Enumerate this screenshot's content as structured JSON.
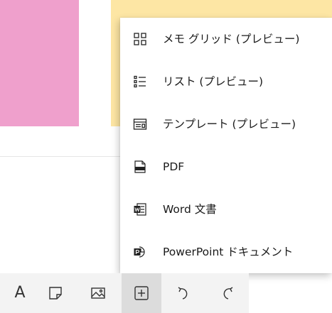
{
  "menu": {
    "items": [
      {
        "label": "メモ グリッド (プレビュー)",
        "icon": "grid-icon"
      },
      {
        "label": "リスト (プレビュー)",
        "icon": "list-icon"
      },
      {
        "label": "テンプレート (プレビュー)",
        "icon": "template-icon"
      },
      {
        "label": "PDF",
        "icon": "pdf-icon"
      },
      {
        "label": "Word 文書",
        "icon": "word-icon"
      },
      {
        "label": "PowerPoint ドキュメント",
        "icon": "powerpoint-icon"
      }
    ]
  },
  "toolbar": {
    "text_glyph": "A",
    "buttons": [
      "text-icon",
      "sticky-note-icon",
      "image-icon",
      "insert-icon",
      "undo-icon",
      "redo-icon"
    ],
    "active": "insert-icon"
  },
  "colors": {
    "pink_note": "#efa0cc",
    "yellow_note": "#fde6a4",
    "toolbar_bg": "#f3f3f3",
    "active_bg": "#dcdcdc"
  }
}
